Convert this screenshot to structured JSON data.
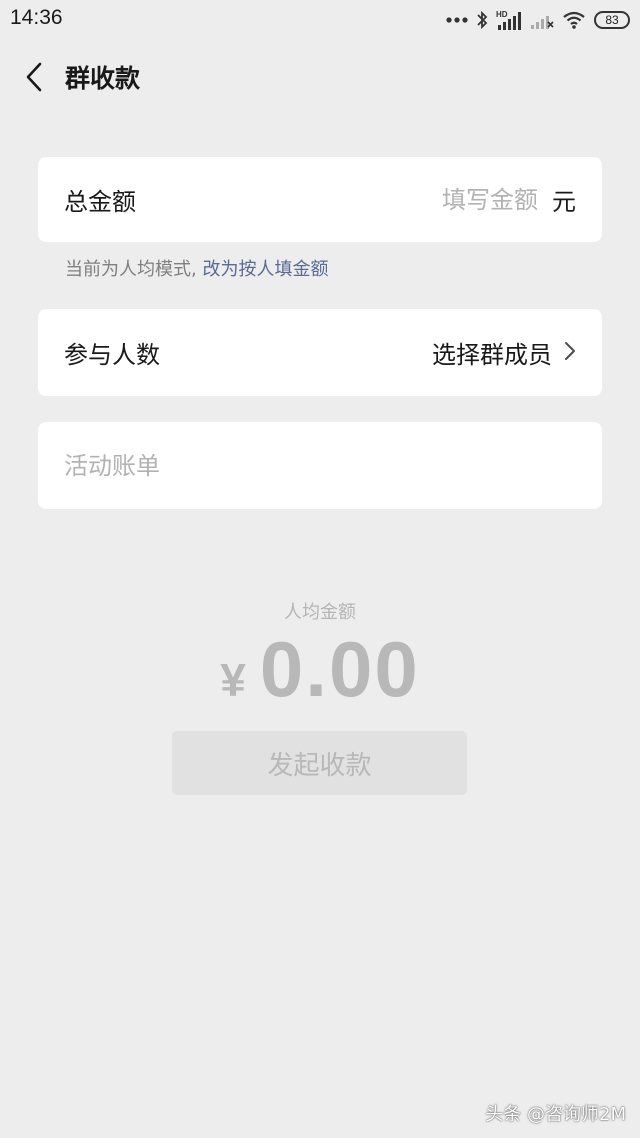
{
  "status_bar": {
    "time": "14:36",
    "battery": "83",
    "icons": [
      "more-dots-icon",
      "bluetooth-icon",
      "hd-signal-icon",
      "signal-icon",
      "wifi-icon",
      "battery-icon"
    ]
  },
  "header": {
    "title": "群收款",
    "back_icon": "back-arrow-icon"
  },
  "total_amount": {
    "label": "总金额",
    "placeholder": "填写金额",
    "value": "",
    "unit": "元"
  },
  "mode_hint": {
    "text": "当前为人均模式,",
    "link": "改为按人填金额"
  },
  "participants": {
    "label": "参与人数",
    "action": "选择群成员",
    "icon": "chevron-right-icon"
  },
  "activity_bill": {
    "placeholder": "活动账单",
    "value": ""
  },
  "per_person": {
    "label": "人均金额",
    "currency": "¥",
    "amount": "0.00"
  },
  "submit": {
    "label": "发起收款"
  },
  "watermark": {
    "text": "头条 @咨询师2M"
  },
  "colors": {
    "background": "#ededed",
    "card": "#ffffff",
    "link": "#576b95",
    "placeholder": "#b2b2b2",
    "disabled_button": "#e1e1e1"
  }
}
